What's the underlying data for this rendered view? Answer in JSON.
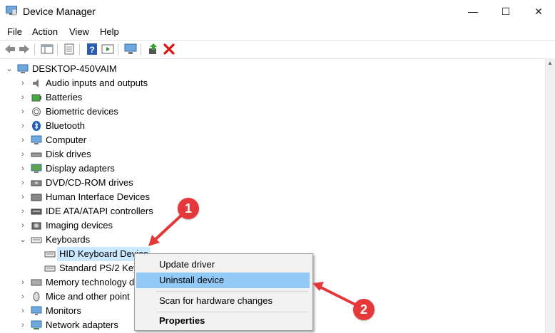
{
  "window": {
    "title": "Device Manager",
    "minimize": "—",
    "maximize": "☐",
    "close": "✕"
  },
  "menu": {
    "file": "File",
    "action": "Action",
    "view": "View",
    "help": "Help"
  },
  "tree": {
    "root": "DESKTOP-450VAIM",
    "categories": [
      "Audio inputs and outputs",
      "Batteries",
      "Biometric devices",
      "Bluetooth",
      "Computer",
      "Disk drives",
      "Display adapters",
      "DVD/CD-ROM drives",
      "Human Interface Devices",
      "IDE ATA/ATAPI controllers",
      "Imaging devices",
      "Keyboards",
      "Memory technology d",
      "Mice and other point",
      "Monitors",
      "Network adapters"
    ],
    "keyboard_children": [
      "HID Keyboard Device",
      "Standard PS/2 Key"
    ]
  },
  "context_menu": {
    "update_driver": "Update driver",
    "uninstall_device": "Uninstall device",
    "scan": "Scan for hardware changes",
    "properties": "Properties"
  },
  "annotations": {
    "badge1": "1",
    "badge2": "2"
  },
  "colors": {
    "selection": "#cce8ff",
    "menu_hover": "#91c9f7",
    "badge": "#e5383b"
  }
}
